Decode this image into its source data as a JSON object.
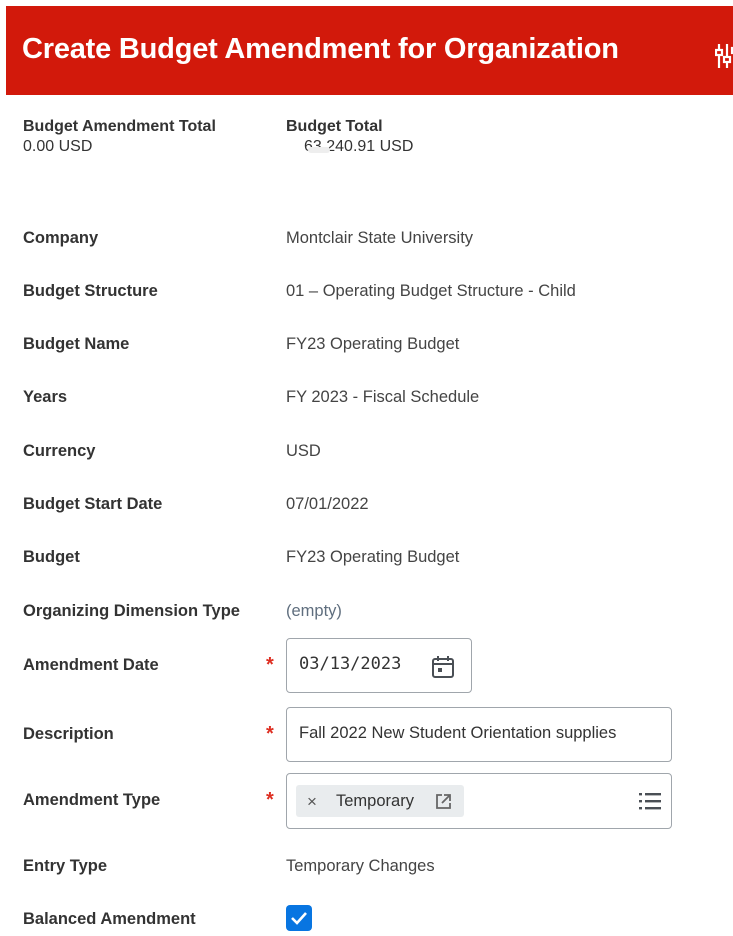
{
  "header": {
    "title": "Create Budget Amendment for Organization",
    "icon": "related-actions-icon",
    "color": "#d2190b"
  },
  "totals": {
    "amendment_total_label": "Budget Amendment Total",
    "amendment_total_value": "0.00 USD",
    "budget_total_label": "Budget Total",
    "budget_total_value": "63,240.91 USD"
  },
  "fields": {
    "company": {
      "label": "Company",
      "value": "Montclair State University"
    },
    "budget_structure": {
      "label": "Budget Structure",
      "value": "01 – Operating Budget Structure - Child"
    },
    "budget_name": {
      "label": "Budget Name",
      "value": "FY23 Operating Budget"
    },
    "years": {
      "label": "Years",
      "value": "FY 2023 - Fiscal Schedule"
    },
    "currency": {
      "label": "Currency",
      "value": "USD"
    },
    "budget_start_date": {
      "label": "Budget Start Date",
      "value": "07/01/2022"
    },
    "budget": {
      "label": "Budget",
      "value": "FY23 Operating Budget"
    },
    "organizing_dimension_type": {
      "label": "Organizing Dimension Type",
      "value": "(empty)"
    },
    "amendment_date": {
      "label": "Amendment Date",
      "value": "03/13/2023",
      "required_mark": "*"
    },
    "description": {
      "label": "Description",
      "value": "Fall 2022 New Student Orientation supplies",
      "required_mark": "*"
    },
    "amendment_type": {
      "label": "Amendment Type",
      "selected": "Temporary",
      "remove_glyph": "×",
      "required_mark": "*"
    },
    "entry_type": {
      "label": "Entry Type",
      "value": "Temporary Changes"
    },
    "balanced_amendment": {
      "label": "Balanced Amendment",
      "checked": true
    }
  },
  "colors": {
    "required": "#de2e21",
    "checkbox": "#0875e1",
    "empty_value": "#5f6e7e"
  }
}
